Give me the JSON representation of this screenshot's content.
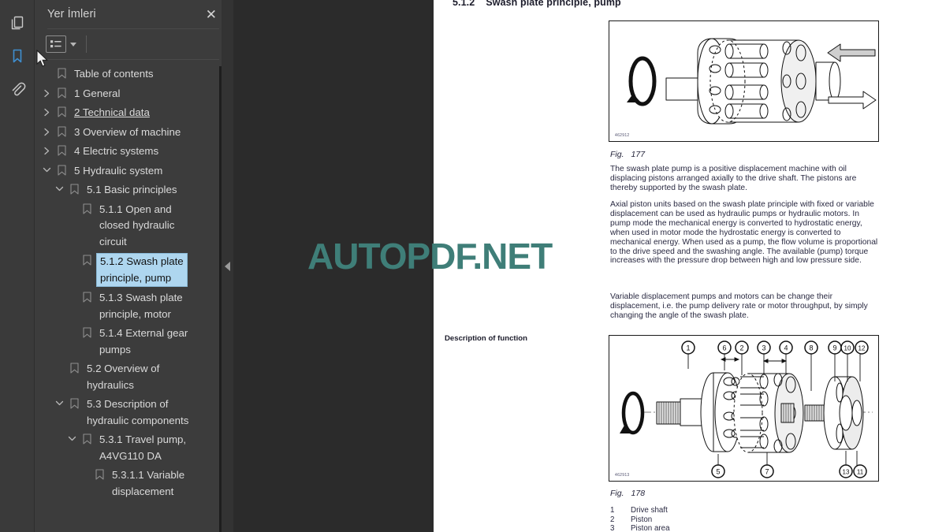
{
  "rail": {
    "items": [
      {
        "icon": "pages-icon",
        "name": "thumbnails-panel-button"
      },
      {
        "icon": "bookmark-icon",
        "name": "bookmarks-panel-button",
        "active": true
      },
      {
        "icon": "paperclip-icon",
        "name": "attachments-panel-button"
      }
    ]
  },
  "panel": {
    "title": "Yer İmleri",
    "close_label": "✕",
    "toolbar": {
      "list_view_icon": "list-view-icon",
      "caret_icon": "chevron-down-icon"
    }
  },
  "bookmarks": [
    {
      "label": "Table of contents",
      "indent": 0,
      "twisty": "none",
      "selected": false,
      "underline": false
    },
    {
      "label": "1 General",
      "indent": 0,
      "twisty": "collapsed",
      "selected": false,
      "underline": false
    },
    {
      "label": "2 Technical data",
      "indent": 0,
      "twisty": "collapsed",
      "selected": false,
      "underline": true
    },
    {
      "label": "3 Overview of machine",
      "indent": 0,
      "twisty": "collapsed",
      "selected": false,
      "underline": false
    },
    {
      "label": "4 Electric systems",
      "indent": 0,
      "twisty": "collapsed",
      "selected": false,
      "underline": false
    },
    {
      "label": "5 Hydraulic system",
      "indent": 0,
      "twisty": "expanded",
      "selected": false,
      "underline": false
    },
    {
      "label": "5.1 Basic principles",
      "indent": 1,
      "twisty": "expanded",
      "selected": false,
      "underline": false
    },
    {
      "label": "5.1.1 Open and\nclosed hydraulic\ncircuit",
      "indent": 2,
      "twisty": "none",
      "selected": false,
      "underline": false
    },
    {
      "label": "5.1.2 Swash plate\nprinciple, pump",
      "indent": 2,
      "twisty": "none",
      "selected": true,
      "underline": false
    },
    {
      "label": "5.1.3 Swash plate\nprinciple, motor",
      "indent": 2,
      "twisty": "none",
      "selected": false,
      "underline": false
    },
    {
      "label": "5.1.4 External gear\npumps",
      "indent": 2,
      "twisty": "none",
      "selected": false,
      "underline": false
    },
    {
      "label": "5.2 Overview of\nhydraulics",
      "indent": 1,
      "twisty": "none",
      "selected": false,
      "underline": false
    },
    {
      "label": "5.3 Description of\nhydraulic components",
      "indent": 1,
      "twisty": "expanded",
      "selected": false,
      "underline": false
    },
    {
      "label": "5.3.1 Travel pump,\nA4VG110 DA",
      "indent": 2,
      "twisty": "expanded",
      "selected": false,
      "underline": false
    },
    {
      "label": "5.3.1.1 Variable\ndisplacement",
      "indent": 3,
      "twisty": "none",
      "selected": false,
      "underline": false
    }
  ],
  "document": {
    "heading_number": "5.1.2",
    "heading_text": "Swash plate principle, pump",
    "sidenote": "Description of function",
    "figures": [
      {
        "caption_label": "Fig.",
        "caption_number": "177",
        "image_id": "462912",
        "alt": "axial piston pump cross-section with rotation arrow and flow arrows"
      },
      {
        "caption_label": "Fig.",
        "caption_number": "178",
        "image_id": "462913",
        "alt": "exploded axial piston pump with numbered callouts 1 to 13"
      }
    ],
    "paragraphs": [
      "The swash plate pump is a positive displacement machine with oil displacing pistons arranged axially to the drive shaft. The pistons are thereby supported by the swash plate.",
      "Axial piston units based on the swash plate principle with fixed or variable displacement can be used as hydraulic pumps or hydraulic motors. In pump mode the mechanical energy is converted to hydrostatic energy, when used in motor mode the hydrostatic energy is converted to mechanical energy. When used as a pump, the flow volume is proportional to the drive speed and the swashing angle. The available (pump) torque increases with the pressure drop between high and low pressure side.",
      "Variable displacement pumps and motors can be change their displacement, i.e. the pump delivery rate or motor throughput, by simply changing the angle of the swash plate."
    ],
    "legend": [
      {
        "num": "1",
        "text": "Drive shaft"
      },
      {
        "num": "2",
        "text": "Piston"
      },
      {
        "num": "3",
        "text": "Piston area"
      }
    ],
    "callouts_top": [
      "1",
      "6",
      "2",
      "3",
      "4",
      "8",
      "9",
      "10",
      "12"
    ],
    "callouts_bottom": [
      "5",
      "7",
      "13",
      "11"
    ]
  },
  "watermark": {
    "text": "AUTOPDF.NET",
    "color": "#3f7e78"
  },
  "colors": {
    "accent": "#3f8fd0",
    "selection": "#aed6ef",
    "panel_bg": "#3c3c3c",
    "rail_bg": "#3a3a3a",
    "viewer_bg": "#2b2b2b",
    "page_bg": "#ffffff"
  }
}
